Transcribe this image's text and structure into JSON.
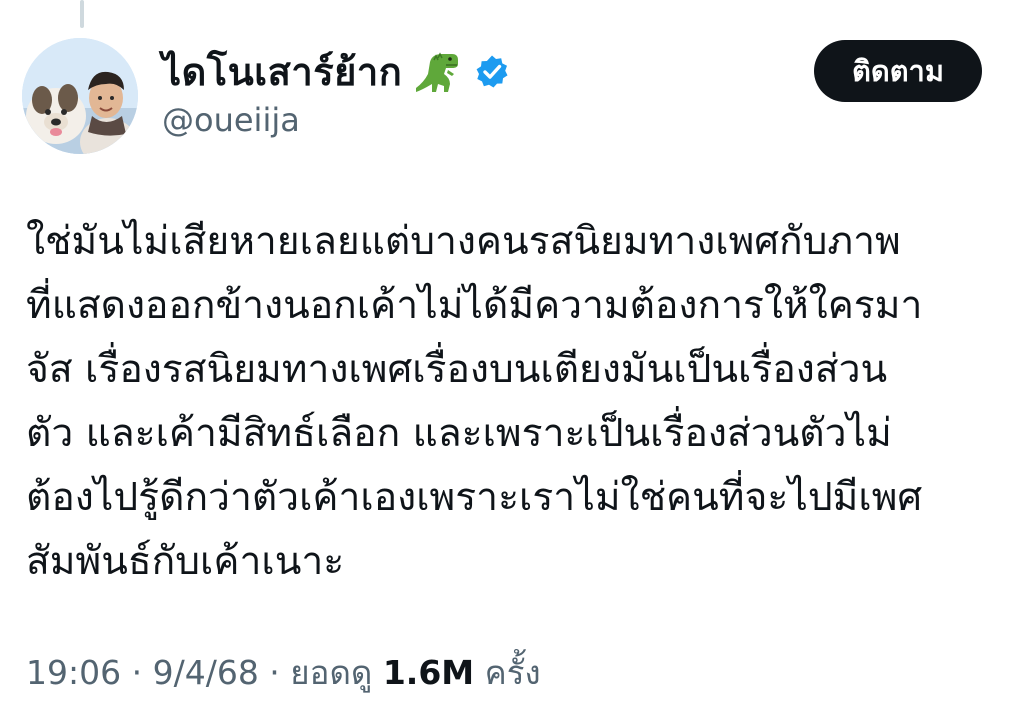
{
  "author": {
    "display_name": "ไดโนเสาร์ย้าก",
    "emoji": "t-rex-emoji",
    "verified": true,
    "handle": "@oueiija"
  },
  "follow_button": {
    "label": "ติดตาม"
  },
  "tweet": {
    "lines": [
      "ใช่มันไม่เสียหายเลยแต่บางคนรสนิยมทางเพศกับภาพ",
      "ที่แสดงออกข้างนอกเค้าไม่ได้มีความต้องการให้ใครมา",
      "จัส เรื่องรสนิยมทางเพศเรื่องบนเตียงมันเป็นเรื่องส่วน",
      "ตัว และเค้ามีสิทธ์เลือก และเพราะเป็นเรื่องส่วนตัวไม่",
      "ต้องไปรู้ดีกว่าตัวเค้าเองเพราะเราไม่ใช่คนที่จะไปมีเพศ",
      "สัมพันธ์กับเค้าเนาะ"
    ]
  },
  "meta": {
    "time": "19:06",
    "separator": " · ",
    "date": "9/4/68",
    "views_label": "ยอดดู",
    "views_count": "1.6M",
    "views_unit": "ครั้ง"
  },
  "colors": {
    "text": "#0f1419",
    "secondary_text": "#536471",
    "verified_blue": "#1d9bf0",
    "button_bg": "#0f1419",
    "button_text": "#ffffff",
    "thread_line": "#cfd9de"
  }
}
